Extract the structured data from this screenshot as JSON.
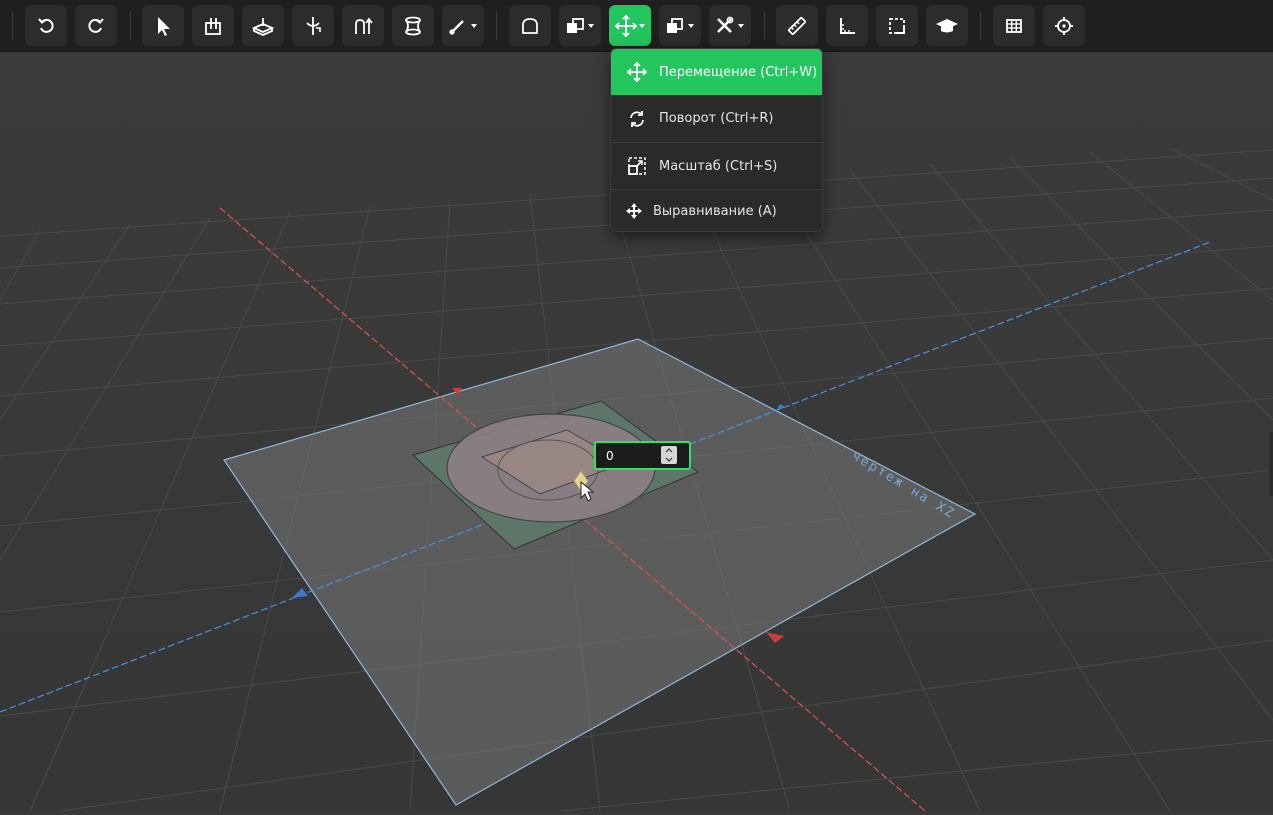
{
  "toolbar": {
    "buttons": [
      {
        "name": "undo",
        "icon": "undo-icon"
      },
      {
        "name": "redo",
        "icon": "redo-icon"
      },
      {
        "name": "select",
        "icon": "cursor-arrow-icon"
      },
      {
        "name": "extrude",
        "icon": "extrude-icon"
      },
      {
        "name": "sketch-plane",
        "icon": "sketch-plane-icon"
      },
      {
        "name": "revolve",
        "icon": "revolve-icon"
      },
      {
        "name": "sweep",
        "icon": "sweep-icon"
      },
      {
        "name": "loft",
        "icon": "loft-icon"
      },
      {
        "name": "fillet-menu",
        "icon": "fillet-icon"
      },
      {
        "name": "shell",
        "icon": "shell-icon"
      },
      {
        "name": "boolean-menu",
        "icon": "boolean-icon"
      },
      {
        "name": "transform-menu",
        "icon": "move-arrows-icon",
        "active": true
      },
      {
        "name": "pattern-menu",
        "icon": "pattern-icon"
      },
      {
        "name": "tools-menu",
        "icon": "tools-icon"
      },
      {
        "name": "measure",
        "icon": "ruler-icon"
      },
      {
        "name": "dimension",
        "icon": "dimension-icon"
      },
      {
        "name": "frame",
        "icon": "frame-icon"
      },
      {
        "name": "tutorial",
        "icon": "graduation-cap-icon"
      },
      {
        "name": "grid",
        "icon": "grid-icon"
      },
      {
        "name": "snap",
        "icon": "crosshair-icon"
      }
    ]
  },
  "transform_menu": {
    "items": [
      {
        "label": "Перемещение (Ctrl+W)",
        "icon": "move-arrows-icon",
        "selected": true
      },
      {
        "label": "Поворот (Ctrl+R)",
        "icon": "rotate-icon"
      },
      {
        "label": "Масштаб (Ctrl+S)",
        "icon": "scale-icon"
      },
      {
        "label": "Выравнивание (A)",
        "icon": "align-icon"
      }
    ]
  },
  "viewport": {
    "plane_label": "чертеж на XZ",
    "distance_input": {
      "value": "0"
    }
  },
  "colors": {
    "accent": "#22c55e",
    "toolbar_bg": "#1f1f1f",
    "viewport_bg": "#3a3a3a",
    "axis_x": "#d9534f",
    "axis_z": "#4a90d9"
  }
}
